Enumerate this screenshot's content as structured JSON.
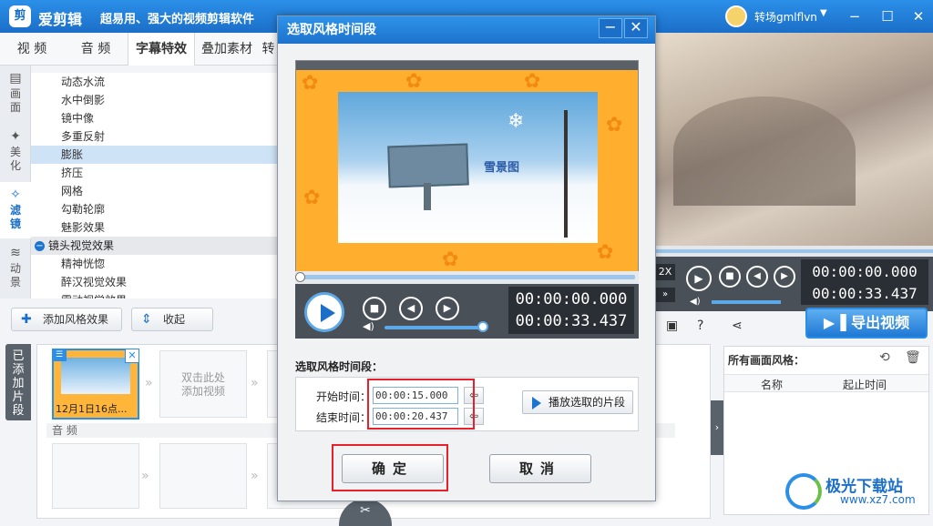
{
  "app": {
    "logo_glyph": "剪",
    "name": "爱剪辑",
    "slogan": "超易用、强大的视频剪辑软件",
    "username": "转场gmlflvn",
    "window_buttons": [
      "−",
      "☐",
      "✕"
    ]
  },
  "main_tabs": [
    "视 频",
    "音 频",
    "字幕特效",
    "叠加素材",
    "转"
  ],
  "side_nav": [
    {
      "label": "画面",
      "icon": "▤"
    },
    {
      "label": "美化",
      "icon": "✦"
    },
    {
      "label": "滤镜",
      "icon": "✧"
    },
    {
      "label": "动景",
      "icon": "≋"
    }
  ],
  "effects": {
    "items_before": [
      "动态水流",
      "水中倒影",
      "镜中像",
      "多重反射"
    ],
    "selected": "膨胀",
    "items_after": [
      "挤压",
      "网格",
      "勾勒轮廓",
      "魅影效果"
    ],
    "group": "镜头视觉效果",
    "group_items": [
      "精神恍惚",
      "醉汉视觉效果",
      "震动视觉效果"
    ]
  },
  "buttons": {
    "add_style": "添加风格效果",
    "collapse": "收起"
  },
  "clips": {
    "tab_label": "已添加片段",
    "clip_label": "12月1日16点...",
    "placeholder": "双击此处\n添加视频",
    "audio_label": "音 频"
  },
  "right": {
    "speed": "2X",
    "time_current": "00:00:00.000",
    "time_total": "00:00:33.437",
    "export_label": "导出视频",
    "styles_title": "所有画面风格：",
    "col_name": "名称",
    "col_time": "起止时间"
  },
  "dialog": {
    "title": "选取风格时间段",
    "preview_caption": "雪景图",
    "time_current": "00:00:00.000",
    "time_total": "00:00:33.437",
    "range_label": "选取风格时间段：",
    "start_label": "开始时间：",
    "start_value": "00:00:15.000",
    "end_label": "结束时间：",
    "end_value": "00:00:20.437",
    "play_range": "播放选取的片段",
    "ok": "确定",
    "cancel": "取消"
  },
  "watermark": {
    "text": "极光下载站",
    "url": "www.xz7.com"
  },
  "colors": {
    "accent": "#1b6fc8",
    "highlight": "#e8202b",
    "leaf": "#f28a12"
  }
}
